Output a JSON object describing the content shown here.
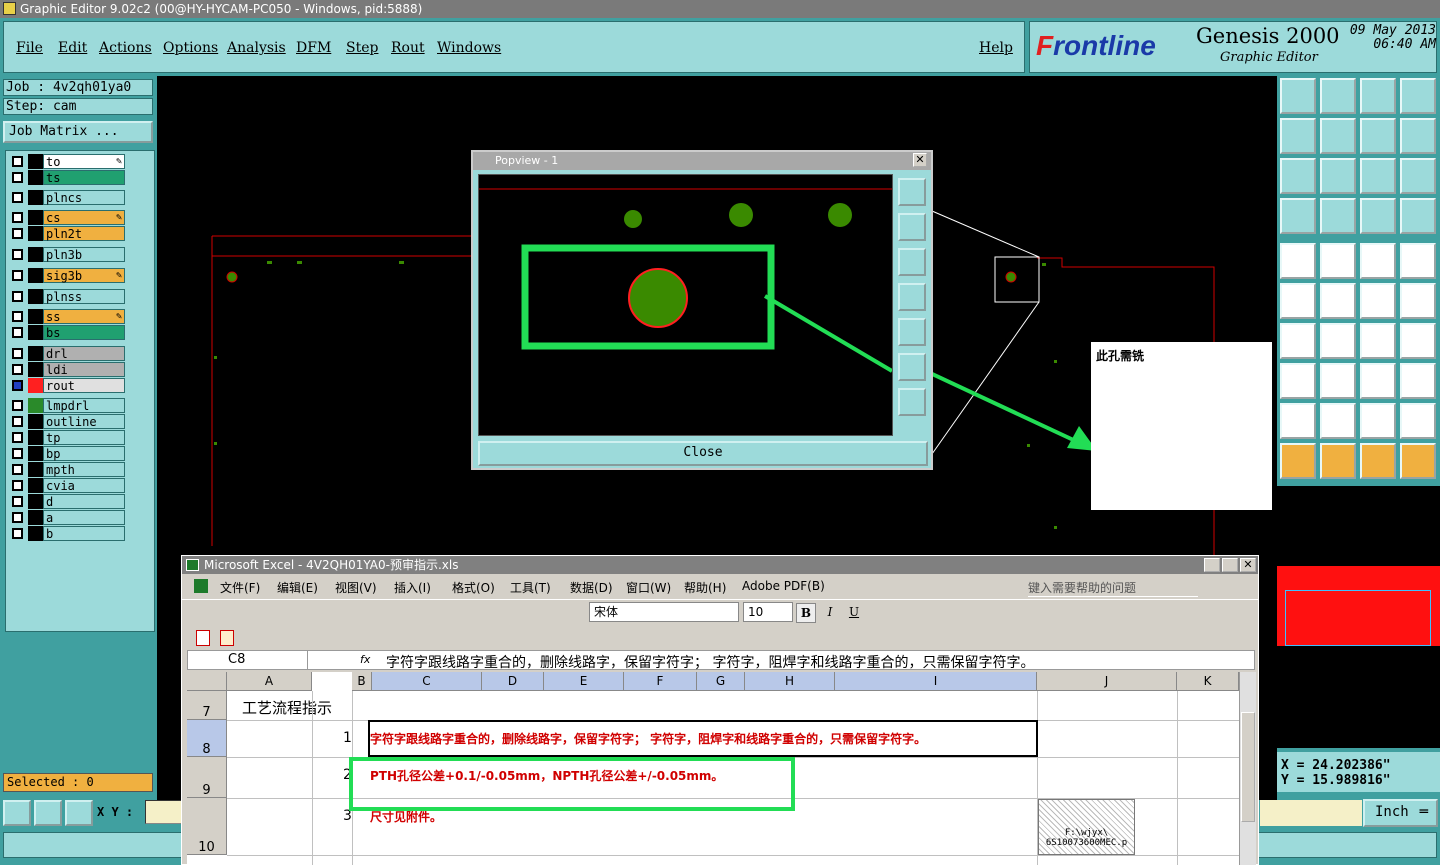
{
  "app": {
    "title": "Graphic Editor 9.02c2 (00@HY-HYCAM-PC050 - Windows, pid:5888)"
  },
  "menu": {
    "items": [
      "File",
      "Edit",
      "Actions",
      "Options",
      "Analysis",
      "DFM",
      "Step",
      "Rout",
      "Windows"
    ],
    "help": "Help"
  },
  "brand": {
    "logo_prefix": "F",
    "logo_rest": "rontline",
    "product": "Genesis 2000",
    "subtitle": "Graphic Editor",
    "date": "09 May 2013",
    "time": "06:40 AM"
  },
  "job": {
    "job_label": "Job : 4v2qh01ya0",
    "step_label": "Step: cam",
    "matrix_button": "Job Matrix ..."
  },
  "layers": [
    {
      "name": "to",
      "color": "#ffffff",
      "swatch": "#000000",
      "bg": "#ffffff",
      "edit": true
    },
    {
      "name": "ts",
      "color": "#20a070",
      "swatch": "#000000",
      "bg": "#20a070",
      "edit": false
    },
    {
      "name": "plncs",
      "color": "#9cdada",
      "swatch": "#000000",
      "bg": "#9cdada",
      "edit": false
    },
    {
      "name": "cs",
      "color": "#f0b040",
      "swatch": "#000000",
      "bg": "#f0b040",
      "edit": true
    },
    {
      "name": "pln2t",
      "color": "#f0b040",
      "swatch": "#000000",
      "bg": "#f0b040",
      "edit": false
    },
    {
      "name": "pln3b",
      "color": "#9cdada",
      "swatch": "#000000",
      "bg": "#9cdada",
      "edit": false
    },
    {
      "name": "sig3b",
      "color": "#f0b040",
      "swatch": "#000000",
      "bg": "#f0b040",
      "edit": true
    },
    {
      "name": "plnss",
      "color": "#9cdada",
      "swatch": "#000000",
      "bg": "#9cdada",
      "edit": false
    },
    {
      "name": "ss",
      "color": "#f0b040",
      "swatch": "#000000",
      "bg": "#f0b040",
      "edit": true
    },
    {
      "name": "bs",
      "color": "#20a070",
      "swatch": "#000000",
      "bg": "#20a070",
      "edit": false
    },
    {
      "name": "drl",
      "color": "#b0b0b0",
      "swatch": "#000000",
      "bg": "#b0b0b0",
      "edit": false
    },
    {
      "name": "ldi",
      "color": "#b0b0b0",
      "swatch": "#000000",
      "bg": "#b0b0b0",
      "edit": false
    },
    {
      "name": "rout",
      "color": "#e0e0e0",
      "swatch": "#ff2020",
      "bg": "#e0e0e0",
      "edit": false,
      "active": true
    },
    {
      "name": "lmpdrl",
      "color": "#9cdada",
      "swatch": "#2a8a2a",
      "bg": "#9cdada",
      "edit": false
    },
    {
      "name": "outline",
      "color": "#9cdada",
      "swatch": "#000000",
      "bg": "#9cdada",
      "edit": false
    },
    {
      "name": "tp",
      "color": "#9cdada",
      "swatch": "#000000",
      "bg": "#9cdada",
      "edit": false
    },
    {
      "name": "bp",
      "color": "#9cdada",
      "swatch": "#000000",
      "bg": "#9cdada",
      "edit": false
    },
    {
      "name": "mpth",
      "color": "#9cdada",
      "swatch": "#000000",
      "bg": "#9cdada",
      "edit": false
    },
    {
      "name": "cvia",
      "color": "#9cdada",
      "swatch": "#000000",
      "bg": "#9cdada",
      "edit": false
    },
    {
      "name": "d",
      "color": "#9cdada",
      "swatch": "#000000",
      "bg": "#9cdada",
      "edit": false
    },
    {
      "name": "a",
      "color": "#9cdada",
      "swatch": "#000000",
      "bg": "#9cdada",
      "edit": false
    },
    {
      "name": "b",
      "color": "#9cdada",
      "swatch": "#000000",
      "bg": "#9cdada",
      "edit": false
    }
  ],
  "status": {
    "selected": "Selected : 0",
    "xy_label": "X Y :",
    "units": "Inch"
  },
  "coords": {
    "x": "X = 24.202386\"",
    "y": "Y = 15.989816\""
  },
  "popview": {
    "title": "Popview - 1",
    "close_label": "Close"
  },
  "note": {
    "text": "此孔需铣"
  },
  "excel": {
    "title": "Microsoft Excel - 4V2QH01YA0-预审指示.xls",
    "menu": [
      "文件(F)",
      "编辑(E)",
      "视图(V)",
      "插入(I)",
      "格式(O)",
      "工具(T)",
      "数据(D)",
      "窗口(W)",
      "帮助(H)",
      "Adobe PDF(B)"
    ],
    "help_placeholder": "键入需要帮助的问题",
    "font_name": "宋体",
    "font_size": "10",
    "name_box": "C8",
    "fx": "fx",
    "formula": "字符字跟线路字重合的，删除线路字，保留字符字；  字符字，阻焊字和线路字重合的，只需保留字符字。",
    "columns": [
      "A",
      "B",
      "C",
      "D",
      "E",
      "F",
      "G",
      "H",
      "I",
      "J",
      "K"
    ],
    "rows": [
      {
        "num": "7",
        "a": "工艺流程指示",
        "b": "",
        "c": ""
      },
      {
        "num": "8",
        "a": "",
        "b": "1",
        "c": "字符字跟线路字重合的，删除线路字，保留字符字；  字符字，阻焊字和线路字重合的，只需保留字符字。"
      },
      {
        "num": "9",
        "a": "",
        "b": "2",
        "c": "PTH孔径公差+0.1/-0.05mm，NPTH孔径公差+/-0.05mm。"
      },
      {
        "num": "10",
        "a": "",
        "b": "3",
        "c": "尺寸见附件。"
      }
    ],
    "attachment_label": "F:\\wjyx\\ 6S10073600MEC.p"
  },
  "colors": {
    "panel_teal": "#40a0a0",
    "light_teal": "#9cdada",
    "highlight_green": "#22dd55",
    "rout_red": "#d00000",
    "pad_green": "#3a8a00"
  }
}
